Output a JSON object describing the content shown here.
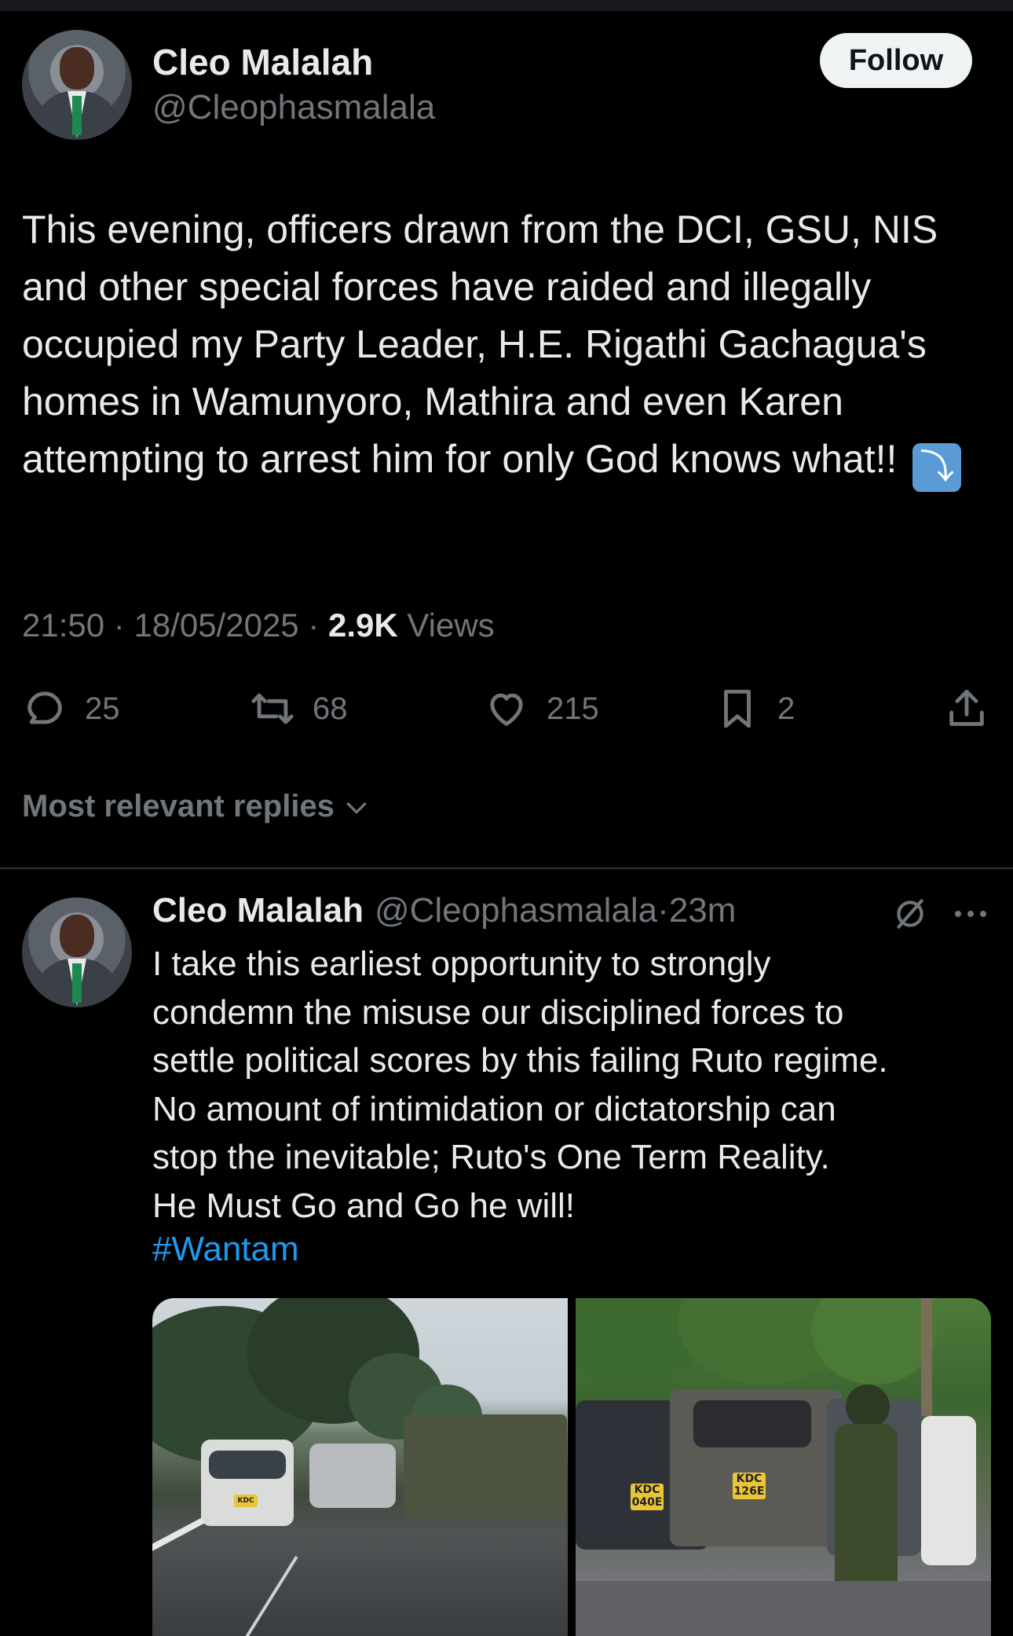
{
  "tweet": {
    "author_name": "Cleo Malalah",
    "author_handle": "@Cleophasmalala",
    "follow_label": "Follow",
    "text": "This evening, officers drawn from the DCI, GSU, NIS and other special forces have raided and illegally occupied my Party Leader, H.E. Rigathi Gachagua's homes in Wamunyoro, Mathira and even Karen attempting to arrest him for only God knows what!!",
    "emoji": "⤵",
    "time": "21:50",
    "date": "18/05/2025",
    "views_count": "2.9K",
    "views_label": "Views",
    "sep": "·"
  },
  "actions": {
    "replies": "25",
    "reposts": "68",
    "likes": "215",
    "bookmarks": "2",
    "icons": [
      "reply-icon",
      "repost-icon",
      "like-icon",
      "bookmark-icon",
      "share-icon"
    ]
  },
  "replies_filter": {
    "label": "Most relevant replies"
  },
  "reply": {
    "author_name": "Cleo Malalah",
    "author_handle": "@Cleophasmalala",
    "sep": "·",
    "time": "23m",
    "text": "I take this earliest opportunity to strongly\ncondemn the misuse our disciplined forces to\nsettle political scores by this failing Ruto regime.\nNo amount of intimidation or dictatorship can\nstop the inevitable; Ruto's One Term Reality.\nHe Must Go and Go he will!",
    "hashtag": "#Wantam",
    "photos": {
      "plate_1": "KDC 040E",
      "plate_2": "KDC 126E"
    }
  },
  "colors": {
    "background": "#000000",
    "text_primary": "#e7e9ea",
    "text_secondary": "#71767b",
    "link": "#1d9bf0",
    "follow_bg": "#eff3f4"
  }
}
